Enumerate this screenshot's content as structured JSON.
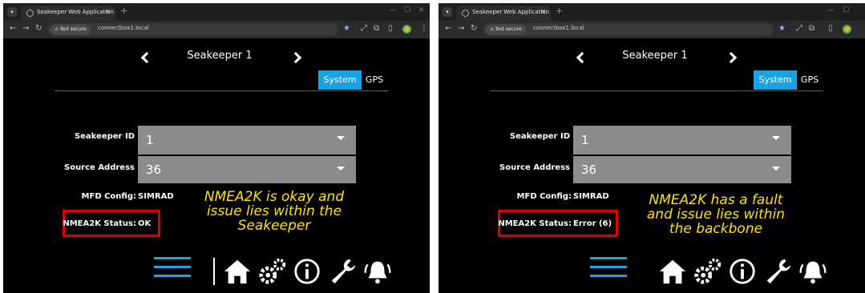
{
  "browser": {
    "tab_title": "Seakeeper Web Application",
    "not_secure": "Not secure",
    "url": "connectbox1.local"
  },
  "app": {
    "device_name": "Seakeeper 1",
    "tabs": [
      "System",
      "GPS"
    ],
    "seakeeper_id_label": "Seakeeper ID",
    "seakeeper_id_value": "1",
    "source_address_label": "Source Address",
    "source_address_value": "36",
    "mfd_config_label": "MFD Config:",
    "mfd_config_value": "SIMRAD",
    "nmea_status_label": "NMEA2K Status:"
  },
  "left": {
    "nmea_status_value": "OK",
    "note_lines": [
      "NMEA2K is okay and",
      "issue lies within the",
      "Seakeeper"
    ]
  },
  "right": {
    "nmea_status_value": "Error (6)",
    "note_lines": [
      "NMEA2K has a fault",
      "and issue lies within",
      "the backbone"
    ]
  },
  "colors": {
    "accent": "#1aa3e0",
    "annotation": "#ffe300",
    "highlight_box": "#e00000"
  },
  "icons": [
    "menu-icon",
    "home-icon",
    "gears-icon",
    "info-icon",
    "wrench-icon",
    "alarm-bell-icon"
  ]
}
